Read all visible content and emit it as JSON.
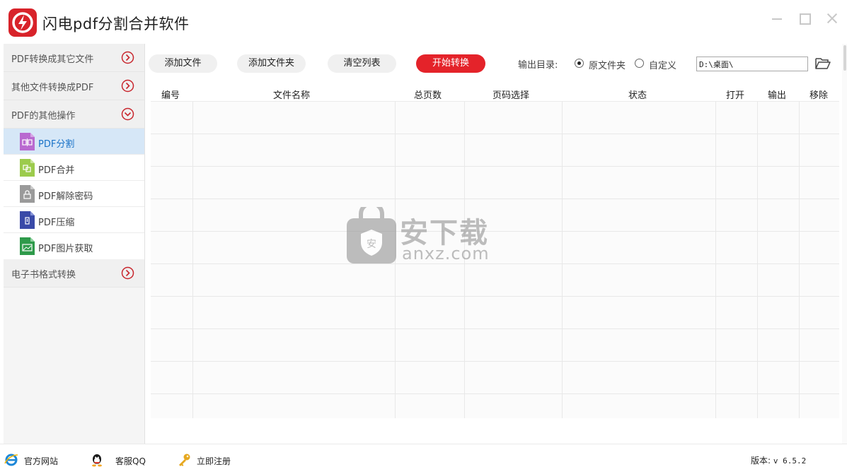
{
  "app": {
    "title": "闪电pdf分割合并软件"
  },
  "sidebar": {
    "categories": [
      {
        "label": "PDF转换成其它文件",
        "expanded": false
      },
      {
        "label": "其他文件转换成PDF",
        "expanded": false
      },
      {
        "label": "PDF的其他操作",
        "expanded": true
      },
      {
        "label": "电子书格式转换",
        "expanded": false
      }
    ],
    "items": [
      {
        "label": "PDF分割",
        "icon": "pdf-split-icon",
        "color": "#b96ad0",
        "active": true
      },
      {
        "label": "PDF合并",
        "icon": "pdf-merge-icon",
        "color": "#9ccb4c",
        "active": false
      },
      {
        "label": "PDF解除密码",
        "icon": "pdf-unlock-icon",
        "color": "#9a9a9a",
        "active": false
      },
      {
        "label": "PDF压缩",
        "icon": "pdf-compress-icon",
        "color": "#3a4aa8",
        "active": false
      },
      {
        "label": "PDF图片获取",
        "icon": "pdf-image-icon",
        "color": "#2e9a4a",
        "active": false
      }
    ]
  },
  "toolbar": {
    "add_file": "添加文件",
    "add_folder": "添加文件夹",
    "clear_list": "清空列表",
    "start": "开始转换",
    "output_label": "输出目录:",
    "radio_original": "原文件夹",
    "radio_custom": "自定义",
    "output_path": "D:\\桌面\\"
  },
  "table": {
    "columns": [
      "编号",
      "文件名称",
      "总页数",
      "页码选择",
      "状态",
      "打开",
      "输出",
      "移除"
    ],
    "rows": []
  },
  "watermark": {
    "text": "安下载",
    "sub": "anxz.com"
  },
  "statusbar": {
    "website": "官方网站",
    "qq": "客服QQ",
    "register": "立即注册",
    "version_label": "版本:",
    "version": "v 6.5.2"
  },
  "colors": {
    "accent": "#e4232a",
    "active_bg": "#d6e7f7",
    "active_text": "#1a73c8"
  }
}
